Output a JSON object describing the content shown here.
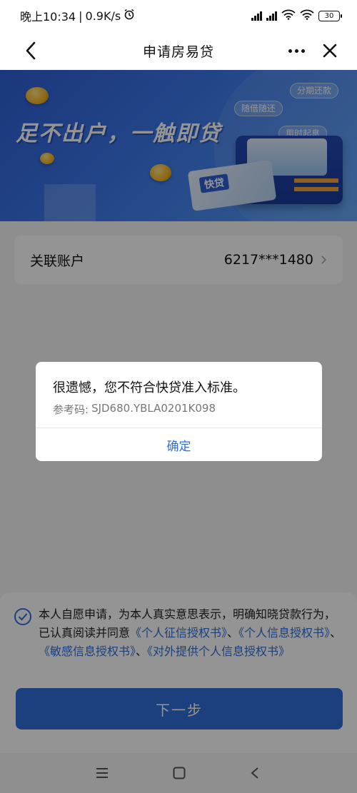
{
  "status_bar": {
    "time": "晚上10:34",
    "separator": "|",
    "speed": "0.9K/s",
    "battery": "30"
  },
  "nav": {
    "title": "申请房易贷"
  },
  "banner": {
    "headline": "足不出户，一触即贷",
    "tags": [
      "分期还款",
      "随借随还",
      "用时起息"
    ],
    "card_label": "快贷"
  },
  "account": {
    "label": "关联账户",
    "value": "6217***1480"
  },
  "agreement": {
    "text_prefix": "本人自愿申请，为本人真实意思表示，明确知晓贷款行为，已认真阅读并同意",
    "link1": "《个人征信授权书》",
    "sep1": "、",
    "link2": "《个人信息授权书》",
    "sep2": "、",
    "link3": "《敏感信息授权书》",
    "sep3": "、",
    "link4": "《对外提供个人信息授权书》",
    "checked": true
  },
  "next_button": "下一步",
  "dialog": {
    "message": "很遗憾，您不符合快贷准入标准。",
    "ref_label": "参考码:",
    "ref_code": "SJD680.YBLA0201K098",
    "confirm": "确定"
  },
  "colors": {
    "accent": "#2f6fd8",
    "banner_start": "#2f5fd6",
    "banner_end": "#5aa0f6"
  },
  "icons": {
    "back": "chevron-left-icon",
    "more": "more-dots-icon",
    "close": "close-icon",
    "account_arrow": "chevron-right-icon",
    "check": "check-circle-icon",
    "sys_menu": "menu-icon",
    "sys_home": "home-square-icon",
    "sys_back": "back-triangle-icon"
  }
}
